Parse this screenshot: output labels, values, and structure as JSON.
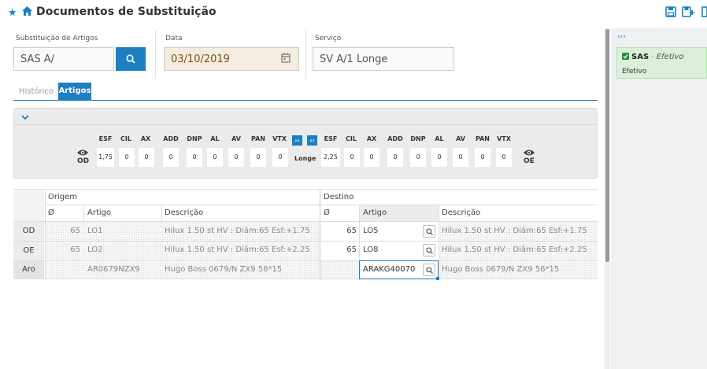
{
  "header": {
    "title": "Documentos de Substituição"
  },
  "form": {
    "subst_label": "Substituição de Artigos",
    "subst_value": "SAS A/",
    "data_label": "Data",
    "data_value": "03/10/2019",
    "servico_label": "Serviço",
    "servico_value": "SV A/1 Longe"
  },
  "tabs": [
    {
      "label": "Histórico",
      "active": false
    },
    {
      "label": "Artigos",
      "active": true
    }
  ],
  "rx": {
    "headers": [
      "ESF",
      "CIL",
      "AX",
      "ADD",
      "DNP",
      "AL",
      "AV",
      "PAN",
      "VTX"
    ],
    "od_label": "OD",
    "oe_label": "OE",
    "od_values": [
      "1,75",
      "0",
      "0",
      "0",
      "0",
      "0",
      "0",
      "0",
      "0"
    ],
    "oe_values": [
      "2,25",
      "0",
      "0",
      "0",
      "0",
      "0",
      "0",
      "0",
      "0"
    ],
    "mode": "Longe",
    "copy_right": "››",
    "copy_left": "‹‹"
  },
  "table": {
    "group_origem": "Origem",
    "group_destino": "Destino",
    "col_diam": "Ø",
    "col_artigo": "Artigo",
    "col_desc": "Descrição",
    "rows": [
      {
        "label": "OD",
        "o_diam": "65",
        "o_artigo": "LO1",
        "o_desc": "Hilux 1.50 st HV : Diâm:65 Esf:+1.75",
        "d_diam": "65",
        "d_artigo": "LO5",
        "d_desc": "Hilux 1.50 st HV : Diâm:65 Esf:+1.75"
      },
      {
        "label": "OE",
        "o_diam": "65",
        "o_artigo": "LO2",
        "o_desc": "Hilux 1.50 st HV : Diâm:65 Esf:+2.25",
        "d_diam": "65",
        "d_artigo": "LO8",
        "d_desc": "Hilux 1.50 st HV : Diâm:65 Esf:+2.25"
      },
      {
        "label": "Aro",
        "o_diam": "",
        "o_artigo": "AR0679NZX9",
        "o_desc": "Hugo Boss 0679/N ZX9 56*15",
        "d_diam": "",
        "d_artigo": "ARAKG40070",
        "d_desc": "Hugo Boss 0679/N ZX9 56*15"
      }
    ]
  },
  "side": {
    "collapse": "›››",
    "card_title": "SAS",
    "card_status_inline": "Efetivo",
    "card_status": "Efetivo"
  },
  "colors": {
    "accent": "#1b7fc1",
    "card_bg": "#dcefd8",
    "check": "#2d8a36"
  }
}
